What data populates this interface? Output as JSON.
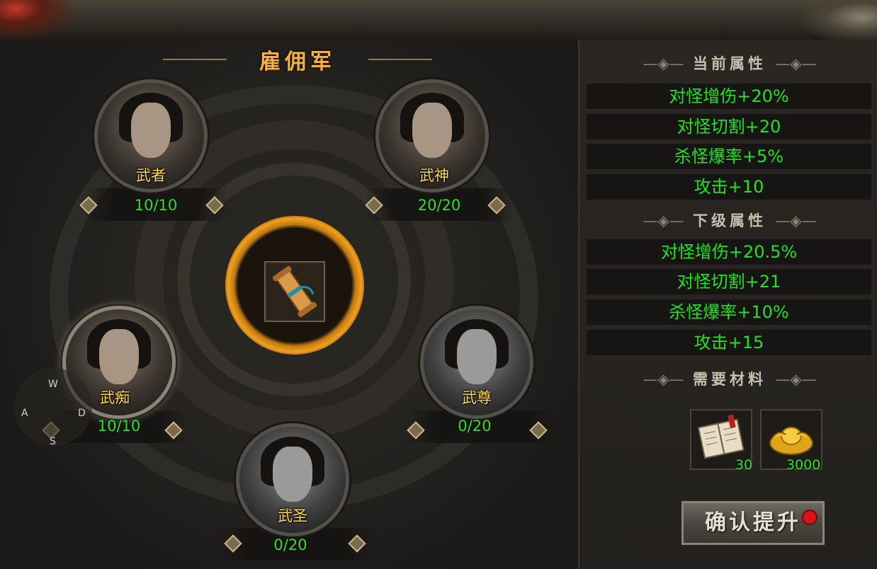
{
  "panel": {
    "title": "雇佣军"
  },
  "units": [
    {
      "name": "武者",
      "count": "10/10"
    },
    {
      "name": "武神",
      "count": "20/20"
    },
    {
      "name": "武痴",
      "count": "10/10"
    },
    {
      "name": "武尊",
      "count": "0/20"
    },
    {
      "name": "武圣",
      "count": "0/20"
    }
  ],
  "current": {
    "heading": "当前属性",
    "attrs": [
      "对怪增伤+20%",
      "对怪切割+20",
      "杀怪爆率+5%",
      "攻击+10"
    ]
  },
  "next": {
    "heading": "下级属性",
    "attrs": [
      "对怪增伤+20.5%",
      "对怪切割+21",
      "杀怪爆率+10%",
      "攻击+15"
    ]
  },
  "materials": {
    "heading": "需要材料",
    "items": [
      {
        "icon": "book-icon",
        "qty": "30"
      },
      {
        "icon": "gold-ingot-icon",
        "qty": "3000"
      }
    ]
  },
  "confirm_label": "确认提升",
  "joystick": {
    "w": "W",
    "a": "A",
    "s": "S",
    "d": "D"
  }
}
